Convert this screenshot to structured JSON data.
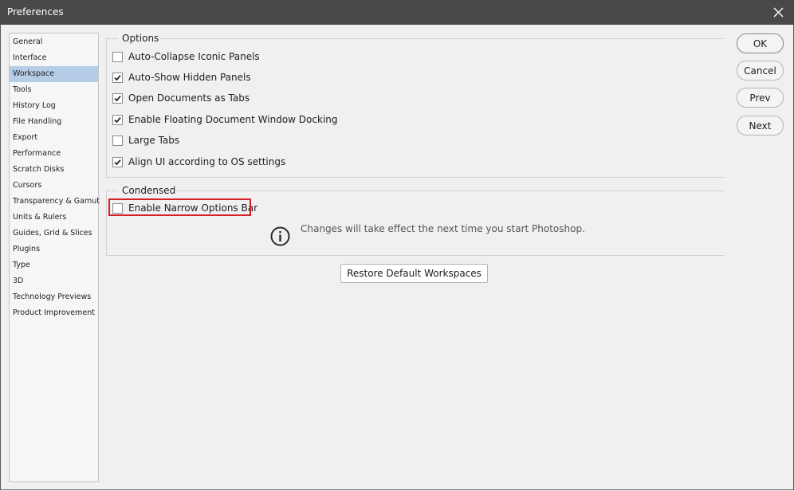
{
  "window": {
    "title": "Preferences"
  },
  "sidebar": {
    "items": [
      {
        "label": "General"
      },
      {
        "label": "Interface"
      },
      {
        "label": "Workspace",
        "selected": true
      },
      {
        "label": "Tools"
      },
      {
        "label": "History Log"
      },
      {
        "label": "File Handling"
      },
      {
        "label": "Export"
      },
      {
        "label": "Performance"
      },
      {
        "label": "Scratch Disks"
      },
      {
        "label": "Cursors"
      },
      {
        "label": "Transparency & Gamut"
      },
      {
        "label": "Units & Rulers"
      },
      {
        "label": "Guides, Grid & Slices"
      },
      {
        "label": "Plugins"
      },
      {
        "label": "Type"
      },
      {
        "label": "3D"
      },
      {
        "label": "Technology Previews"
      },
      {
        "label": "Product Improvement"
      }
    ]
  },
  "options": {
    "title": "Options",
    "items": [
      {
        "label": "Auto-Collapse Iconic Panels",
        "checked": false
      },
      {
        "label": "Auto-Show Hidden Panels",
        "checked": true
      },
      {
        "label": "Open Documents as Tabs",
        "checked": true
      },
      {
        "label": "Enable Floating Document Window Docking",
        "checked": true
      },
      {
        "label": "Large Tabs",
        "checked": false
      },
      {
        "label": "Align UI according to OS settings",
        "checked": true
      }
    ]
  },
  "condensed": {
    "title": "Condensed",
    "items": [
      {
        "label": "Enable Narrow Options Bar",
        "checked": false
      }
    ],
    "info_text": "Changes will take effect the next time you start Photoshop."
  },
  "buttons": {
    "ok": "OK",
    "cancel": "Cancel",
    "prev": "Prev",
    "next": "Next",
    "restore": "Restore Default Workspaces"
  },
  "colors": {
    "titlebar": "#484848",
    "selected_item": "#b6cde8",
    "highlight": "#d3202a"
  }
}
